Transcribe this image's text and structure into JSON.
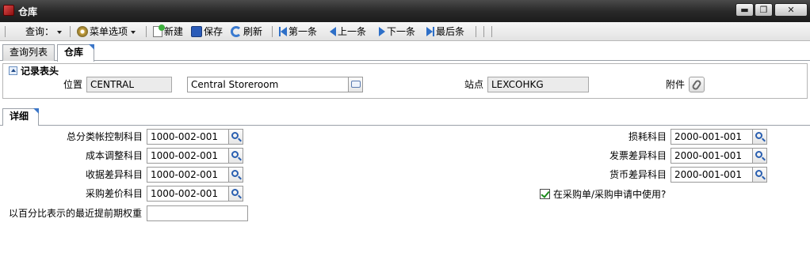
{
  "window": {
    "title": "仓库",
    "minimize_glyph": "▬",
    "maximize_glyph": "❐",
    "close_glyph": "✕"
  },
  "toolbar": {
    "query_label": "查询：",
    "menu_options_label": "菜单选项",
    "new_label": "新建",
    "save_label": "保存",
    "refresh_label": "刷新",
    "first_label": "第一条",
    "prev_label": "上一条",
    "next_label": "下一条",
    "last_label": "最后条"
  },
  "tabs": [
    {
      "label": "查询列表",
      "active": false
    },
    {
      "label": "仓库",
      "active": true
    }
  ],
  "header_section": {
    "title": "记录表头",
    "location_label": "位置",
    "location_value": "CENTRAL",
    "location_desc": "Central Storeroom",
    "site_label": "站点",
    "site_value": "LEXCOHKG",
    "attachments_label": "附件"
  },
  "detail_tab": {
    "label": "详细"
  },
  "detail": {
    "left_fields": [
      {
        "label": "总分类帐控制科目",
        "value": "1000-002-001"
      },
      {
        "label": "成本调整科目",
        "value": "1000-002-001"
      },
      {
        "label": "收据差异科目",
        "value": "1000-002-001"
      },
      {
        "label": "采购差价科目",
        "value": "1000-002-001"
      }
    ],
    "weight_label": "以百分比表示的最近提前期权重",
    "weight_value": "",
    "right_fields": [
      {
        "label": "损耗科目",
        "value": "2000-001-001"
      },
      {
        "label": "发票差异科目",
        "value": "2000-001-001"
      },
      {
        "label": "货币差异科目",
        "value": "2000-001-001"
      }
    ],
    "use_in_po_label": "在采购单/采购申请中使用?",
    "use_in_po_checked": true
  }
}
